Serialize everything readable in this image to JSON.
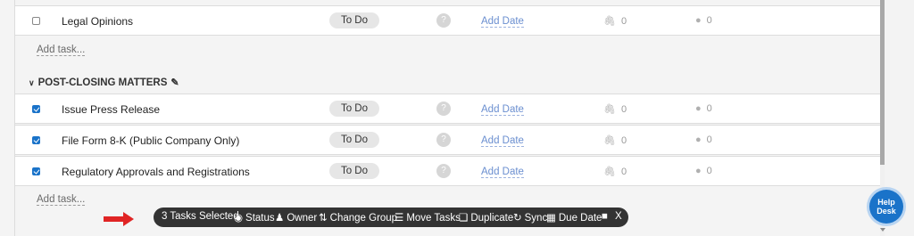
{
  "tasks_top": [
    {
      "name": "Legal Opinions",
      "status": "To Do",
      "owner": "?",
      "date": "Add Date",
      "attachments": "0",
      "comments": "0",
      "checked": false
    }
  ],
  "add_task_label": "Add task...",
  "group": {
    "title": "POST-CLOSING MATTERS",
    "tasks": [
      {
        "name": "Issue Press Release",
        "status": "To Do",
        "owner": "?",
        "date": "Add Date",
        "attachments": "0",
        "comments": "0",
        "checked": true
      },
      {
        "name": "File Form 8-K (Public Company Only)",
        "status": "To Do",
        "owner": "?",
        "date": "Add Date",
        "attachments": "0",
        "comments": "0",
        "checked": true
      },
      {
        "name": "Regulatory Approvals and Registrations",
        "status": "To Do",
        "owner": "?",
        "date": "Add Date",
        "attachments": "0",
        "comments": "0",
        "checked": true
      }
    ]
  },
  "action_bar": {
    "selected": "3 Tasks Selected",
    "status": "Status",
    "owner": "Owner",
    "change_group": "Change Group",
    "move_tasks": "Move Tasks",
    "duplicate": "Duplicate",
    "sync": "Sync",
    "due_date": "Due Date",
    "close": "X"
  },
  "help": {
    "line1": "Help",
    "line2": "Desk"
  },
  "colors": {
    "accent": "#1a73c9",
    "bar": "#333333",
    "arrow": "#e02424"
  }
}
